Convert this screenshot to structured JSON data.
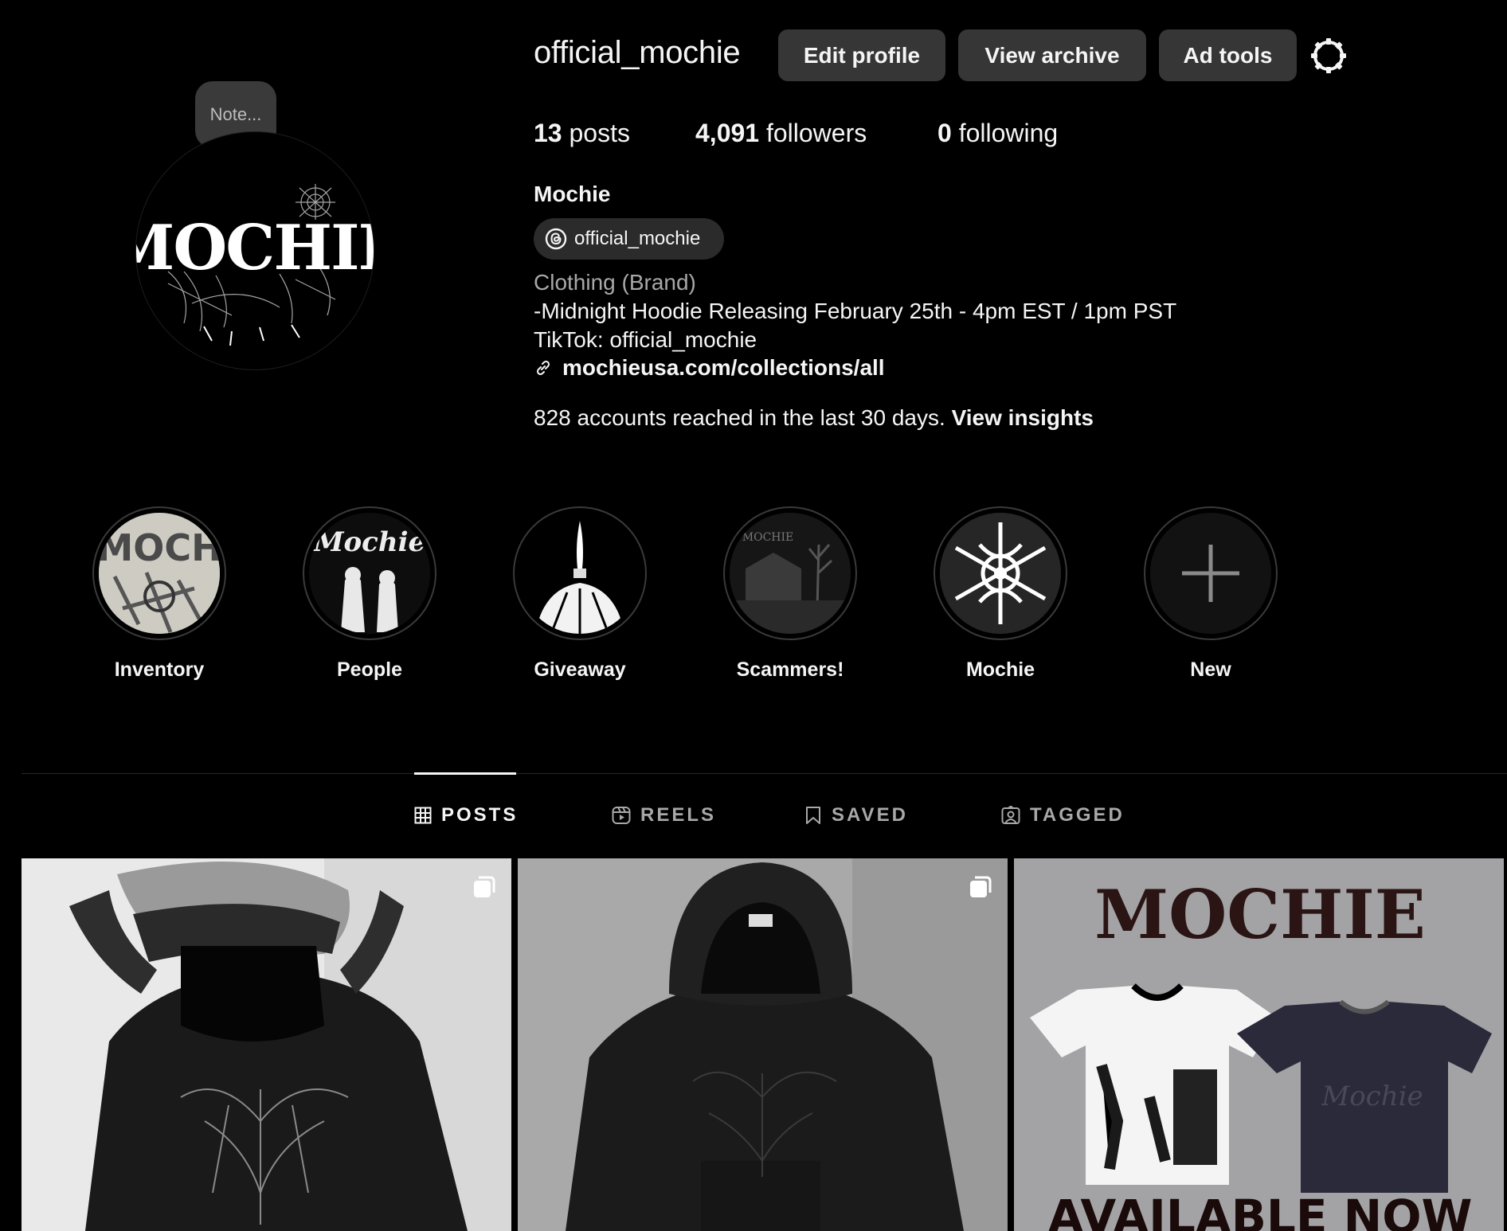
{
  "profile": {
    "username": "official_mochie",
    "note_placeholder": "Note...",
    "avatar_logo_text": "MOCHIE",
    "buttons": {
      "edit_profile": "Edit profile",
      "view_archive": "View archive",
      "ad_tools": "Ad tools"
    },
    "stats": {
      "posts_count": "13",
      "posts_label": "posts",
      "followers_count": "4,091",
      "followers_label": "followers",
      "following_count": "0",
      "following_label": "following"
    },
    "display_name": "Mochie",
    "threads_handle": "official_mochie",
    "category": "Clothing (Brand)",
    "bio_line_1": "-Midnight Hoodie Releasing February 25th - 4pm EST / 1pm PST",
    "bio_line_2": "TikTok: official_mochie",
    "link": "mochieusa.com/collections/all",
    "insights_text": "828 accounts reached in the last 30 days.",
    "insights_link": "View insights"
  },
  "highlights": [
    {
      "label": "Inventory"
    },
    {
      "label": "People"
    },
    {
      "label": "Giveaway"
    },
    {
      "label": "Scammers!"
    },
    {
      "label": "Mochie"
    },
    {
      "label": "New"
    }
  ],
  "tabs": [
    {
      "label": "POSTS",
      "active": true
    },
    {
      "label": "REELS",
      "active": false
    },
    {
      "label": "SAVED",
      "active": false
    },
    {
      "label": "TAGGED",
      "active": false
    }
  ],
  "posts": [
    {
      "multi": true
    },
    {
      "multi": true
    },
    {
      "multi": false,
      "brand_text": "MOCHIE",
      "overlay_text": "AVAILABLE NOW"
    }
  ],
  "colors": {
    "background": "#000000",
    "button_bg": "#363636",
    "text_primary": "#f5f5f5",
    "text_secondary": "#a8a8a8"
  }
}
